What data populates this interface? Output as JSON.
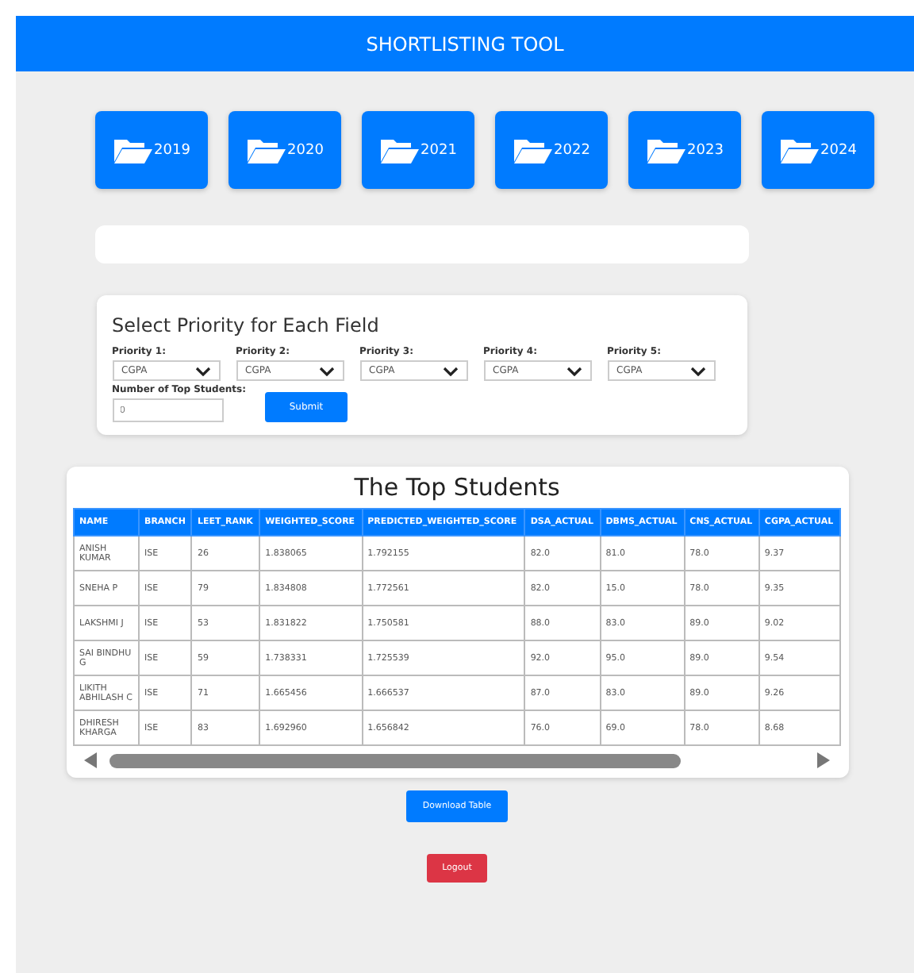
{
  "header": {
    "title": "SHORTLISTING TOOL"
  },
  "folders": [
    "2019",
    "2020",
    "2021",
    "2022",
    "2023",
    "2024"
  ],
  "priority_form": {
    "title": "Select Priority for Each Field",
    "priorities": [
      {
        "label": "Priority 1:",
        "value": "CGPA"
      },
      {
        "label": "Priority 2:",
        "value": "CGPA"
      },
      {
        "label": "Priority 3:",
        "value": "CGPA"
      },
      {
        "label": "Priority 4:",
        "value": "CGPA"
      },
      {
        "label": "Priority 5:",
        "value": "CGPA"
      }
    ],
    "top_students": {
      "label": "Number of Top Students:",
      "placeholder": "0"
    },
    "submit": "Submit"
  },
  "table": {
    "title": "The Top Students",
    "columns": [
      "NAME",
      "BRANCH",
      "LEET_RANK",
      "WEIGHTED_SCORE",
      "PREDICTED_WEIGHTED_SCORE",
      "DSA_ACTUAL",
      "DBMS_ACTUAL",
      "CNS_ACTUAL",
      "CGPA_ACTUAL"
    ],
    "rows": [
      [
        "ANISH KUMAR",
        "ISE",
        "26",
        "1.838065",
        "1.792155",
        "82.0",
        "81.0",
        "78.0",
        "9.37"
      ],
      [
        "SNEHA P",
        "ISE",
        "79",
        "1.834808",
        "1.772561",
        "82.0",
        "15.0",
        "78.0",
        "9.35"
      ],
      [
        "LAKSHMI J",
        "ISE",
        "53",
        "1.831822",
        "1.750581",
        "88.0",
        "83.0",
        "89.0",
        "9.02"
      ],
      [
        "SAI BINDHU G",
        "ISE",
        "59",
        "1.738331",
        "1.725539",
        "92.0",
        "95.0",
        "89.0",
        "9.54"
      ],
      [
        "LIKITH ABHILASH C",
        "ISE",
        "71",
        "1.665456",
        "1.666537",
        "87.0",
        "83.0",
        "89.0",
        "9.26"
      ],
      [
        "DHIRESH KHARGA",
        "ISE",
        "83",
        "1.692960",
        "1.656842",
        "76.0",
        "69.0",
        "78.0",
        "8.68"
      ]
    ]
  },
  "download": "Download Table",
  "logout": "Logout"
}
